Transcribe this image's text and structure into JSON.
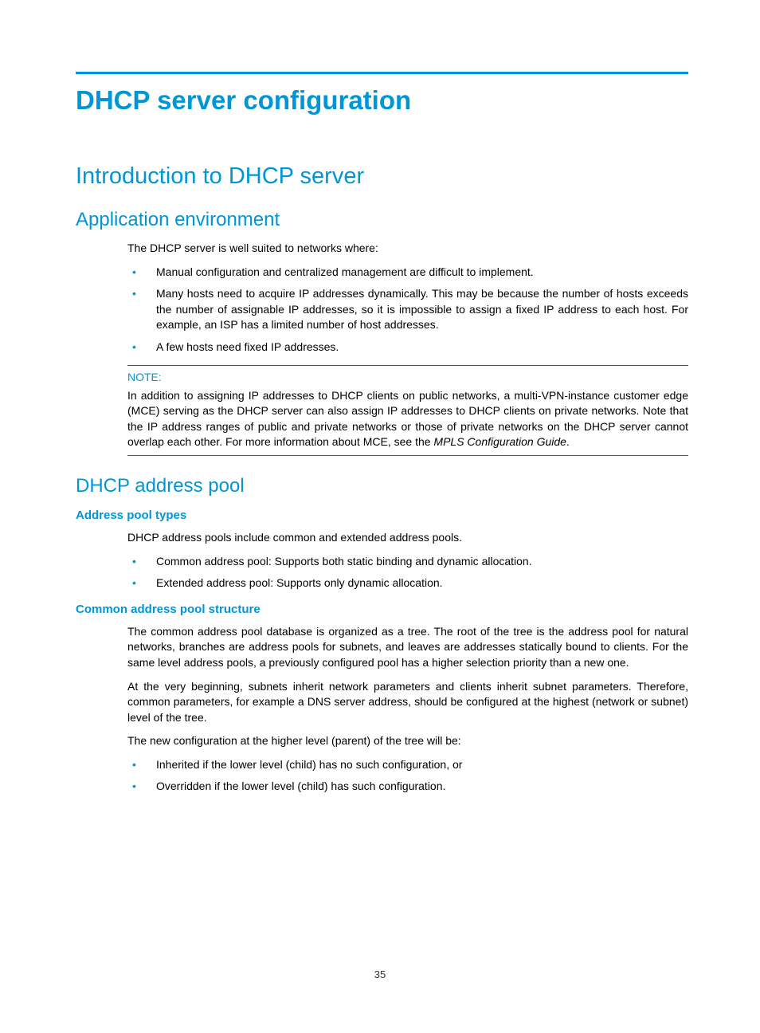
{
  "title": "DHCP server configuration",
  "h2_intro": "Introduction to DHCP server",
  "h3_app_env": "Application environment",
  "p_intro": "The DHCP server is well suited to networks where:",
  "bullets_app_env": [
    "Manual configuration and centralized management are difficult to implement.",
    "Many hosts need to acquire IP addresses dynamically. This may be because the number of hosts exceeds the number of assignable IP addresses, so it is impossible to assign a fixed IP address to each host. For example, an ISP has a limited number of host addresses.",
    "A few hosts need fixed IP addresses."
  ],
  "note": {
    "label": "NOTE:",
    "body_prefix": "In addition to assigning IP addresses to DHCP clients on public networks, a multi-VPN-instance customer edge (MCE) serving as the DHCP server can also assign IP addresses to DHCP clients on private networks. Note that the IP address ranges of public and private networks or those of private networks on the DHCP server cannot overlap each other. For more information about MCE, see the ",
    "body_italic": "MPLS Configuration Guide",
    "body_suffix": "."
  },
  "h3_pool": "DHCP address pool",
  "h4_pool_types": "Address pool types",
  "p_pool_types": "DHCP address pools include common and extended address pools.",
  "bullets_pool_types": [
    "Common address pool: Supports both static binding and dynamic allocation.",
    "Extended address pool: Supports only dynamic allocation."
  ],
  "h4_common_structure": "Common address pool structure",
  "p_struct_1": "The common address pool database is organized as a tree. The root of the tree is the address pool for natural networks, branches are address pools for subnets, and leaves are addresses statically bound to clients. For the same level address pools, a previously configured pool has a higher selection priority than a new one.",
  "p_struct_2": "At the very beginning, subnets inherit network parameters and clients inherit subnet parameters. Therefore, common parameters, for example a DNS server address, should be configured at the highest (network or subnet) level of the tree.",
  "p_struct_3": "The new configuration at the higher level (parent) of the tree will be:",
  "bullets_struct": [
    "Inherited if the lower level (child) has no such configuration, or",
    "Overridden if the lower level (child) has such configuration."
  ],
  "page_number": "35"
}
